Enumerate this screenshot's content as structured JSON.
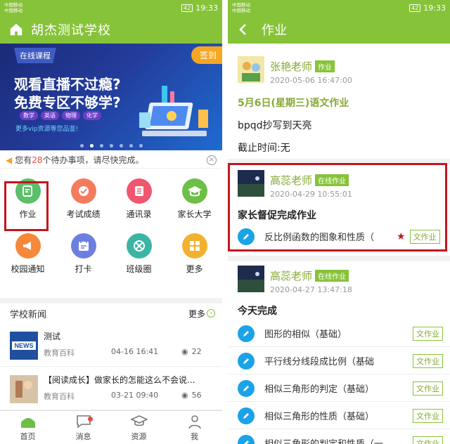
{
  "left": {
    "status": {
      "carrier1": "中国移动",
      "carrier2": "中国移动",
      "battery": "42",
      "time": "19:33"
    },
    "appbar": {
      "title": "胡杰测试学校"
    },
    "banner": {
      "tag": "在线课程",
      "line1": "观看直播不过瘾?",
      "line2": "免费专区不够学?",
      "pills": [
        "数学",
        "英语",
        "物理",
        "化学"
      ],
      "promo": "更多vip资源等您品鉴!",
      "signin": "签到"
    },
    "notice": {
      "prefix": "您有",
      "count": "28",
      "suffix": "个待办事项，请尽快完成。"
    },
    "grid": [
      {
        "label": "作业",
        "icon": "homework-icon",
        "color": "#5cbf6a"
      },
      {
        "label": "考试成绩",
        "icon": "exam-score-icon",
        "color": "#f47b5e"
      },
      {
        "label": "通讯录",
        "icon": "contacts-icon",
        "color": "#f0566e"
      },
      {
        "label": "家长大学",
        "icon": "parent-university-icon",
        "color": "#6dbf45"
      },
      {
        "label": "校园通知",
        "icon": "campus-notice-icon",
        "color": "#f5883a"
      },
      {
        "label": "打卡",
        "icon": "checkin-icon",
        "color": "#6c7fe0"
      },
      {
        "label": "班级圈",
        "icon": "class-circle-icon",
        "color": "#3bb5a3"
      },
      {
        "label": "更多",
        "icon": "more-icon",
        "color": "#f2b22f"
      }
    ],
    "news_header": {
      "title": "学校新闻",
      "more": "更多"
    },
    "news": [
      {
        "title": "测试",
        "source": "教育百科",
        "date": "04-16 16:41",
        "views": "22",
        "thumb": "news-thumb-icon"
      },
      {
        "title": "【阅读成长】做家长的怎能这么不会说...",
        "source": "教育百科",
        "date": "03-21 09:40",
        "views": "56",
        "thumb": "reading-thumb-icon"
      }
    ],
    "tabs": [
      "首页",
      "消息",
      "资源",
      "我"
    ]
  },
  "right": {
    "status": {
      "carrier1": "中国移动",
      "carrier2": "中国移动",
      "battery": "42",
      "time": "19:33"
    },
    "appbar": {
      "title": "作业"
    },
    "posts": [
      {
        "name": "张艳老师",
        "badge": "作业",
        "time": "2020-05-06 16:47:00",
        "title": "5月6日(星期三)语文作业",
        "body": "bpqd抄写到天亮",
        "deadline": "截止时间:无"
      },
      {
        "name": "高蕊老师",
        "badge": "在线作业",
        "time": "2020-04-29 10:55:01",
        "title": "家长督促完成作业",
        "rows": [
          {
            "text": "反比例函数的图象和性质（",
            "tag": "文作业"
          }
        ]
      },
      {
        "name": "高蕊老师",
        "badge": "在线作业",
        "time": "2020-04-27 13:47:18",
        "title": "今天完成",
        "rows": [
          {
            "text": "图形的相似（基础）",
            "tag": "文作业"
          },
          {
            "text": "平行线分线段成比例（基础",
            "tag": "文作业"
          },
          {
            "text": "相似三角形的判定（基础）",
            "tag": "文作业"
          },
          {
            "text": "相似三角形的性质（基础）",
            "tag": "文作业"
          },
          {
            "text": "相似三角形的判定和性质（一",
            "tag": "文作业"
          }
        ]
      }
    ]
  },
  "colors": {
    "brand": "#87c339",
    "highlight": "#c4161c",
    "accent_blue": "#1aa3e8"
  }
}
